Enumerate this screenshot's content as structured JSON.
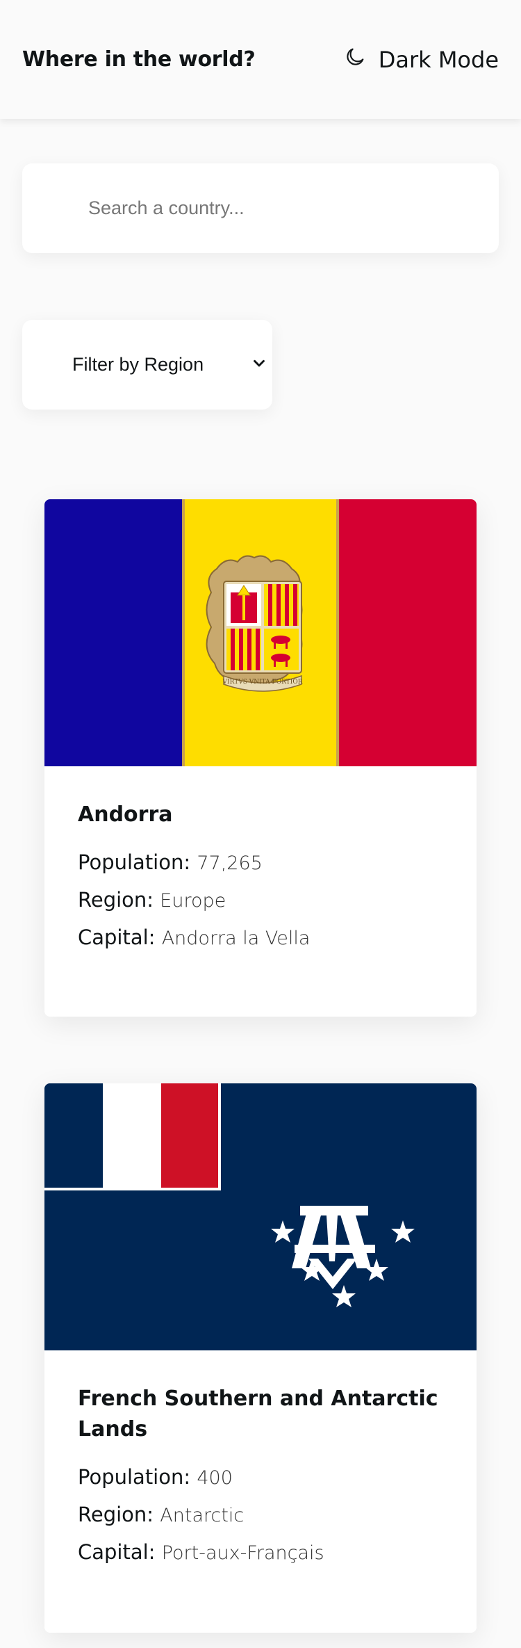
{
  "header": {
    "title": "Where in the world?",
    "theme_toggle_label": "Dark Mode",
    "theme_icon": "moon-icon"
  },
  "search": {
    "placeholder": "Search a country...",
    "value": "",
    "icon": "search-icon"
  },
  "filter": {
    "label": "Filter by Region",
    "icon": "chevron-down-icon"
  },
  "countries": [
    {
      "name": "Andorra",
      "population_label": "Population:",
      "population": "77,265",
      "region_label": "Region:",
      "region": "Europe",
      "capital_label": "Capital:",
      "capital": "Andorra la Vella",
      "flag_icon": "andorra-flag",
      "flag_motto": "VIRTVS VNITA FORTIOR"
    },
    {
      "name": "French Southern and Antarctic Lands",
      "population_label": "Population:",
      "population": "400",
      "region_label": "Region:",
      "region": "Antarctic",
      "capital_label": "Capital:",
      "capital": "Port-aux-Français",
      "flag_icon": "french-southern-antarctic-lands-flag"
    }
  ],
  "colors": {
    "background": "#fafafa",
    "card": "#ffffff",
    "text": "#111517",
    "andorra_blue": "#10069f",
    "andorra_yellow": "#fedd00",
    "andorra_red": "#d50032",
    "taaf_navy": "#002654",
    "french_red": "#ce1126"
  }
}
